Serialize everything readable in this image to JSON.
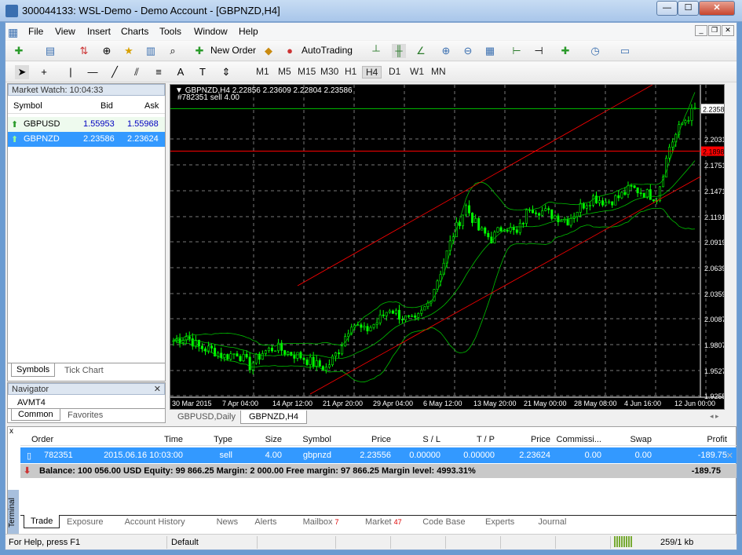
{
  "window": {
    "title": "300044133: WSL-Demo - Demo Account - [GBPNZD,H4]",
    "min": "—",
    "max": "☐",
    "close": "✕"
  },
  "menu": [
    "File",
    "View",
    "Insert",
    "Charts",
    "Tools",
    "Window",
    "Help"
  ],
  "toolbar": {
    "new_order": "New Order",
    "autotrading": "AutoTrading"
  },
  "timeframes": [
    "M1",
    "M5",
    "M15",
    "M30",
    "H1",
    "H4",
    "D1",
    "W1",
    "MN"
  ],
  "active_timeframe": "H4",
  "market_watch": {
    "title": "Market Watch: 10:04:33",
    "columns": [
      "Symbol",
      "Bid",
      "Ask"
    ],
    "rows": [
      {
        "symbol": "GBPUSD",
        "bid": "1.55953",
        "ask": "1.55968"
      },
      {
        "symbol": "GBPNZD",
        "bid": "2.23586",
        "ask": "2.23624",
        "selected": true
      }
    ],
    "tabs": [
      "Symbols",
      "Tick Chart"
    ]
  },
  "navigator": {
    "title": "Navigator",
    "item": "AVMT4",
    "tabs": [
      "Common",
      "Favorites"
    ]
  },
  "chart": {
    "header": "GBPNZD,H4  2.22856 2.23609 2.22804 2.23586",
    "order_label": "#782351 sell 4.00",
    "tabs": [
      "GBPUSD,Daily",
      "GBPNZD,H4"
    ],
    "active_tab": "GBPNZD,H4",
    "colors": {
      "background": "#000000",
      "candles": "#00ff00",
      "bands": "#00c000",
      "channel": "#ff0000",
      "grid": "#c0c0c0"
    }
  },
  "chart_data": {
    "type": "candlestick",
    "symbol": "GBPNZD",
    "timeframe": "H4",
    "y_ticks": [
      "2.20310",
      "2.17510",
      "2.14710",
      "2.11910",
      "2.09190",
      "2.06390",
      "2.03590",
      "2.00870",
      "1.98070",
      "1.95270",
      "1.92550"
    ],
    "ylim": [
      1.9255,
      2.245
    ],
    "x_ticks": [
      "30 Mar 2015",
      "7 Apr 04:00",
      "14 Apr 12:00",
      "21 Apr 20:00",
      "29 Apr 04:00",
      "6 May 12:00",
      "13 May 20:00",
      "21 May 00:00",
      "28 May 08:00",
      "4 Jun 16:00",
      "12 Jun 00:00"
    ],
    "bid_label": "2.23586",
    "order_price_label": "2.18988",
    "order_price": 2.18988,
    "bid": 2.23586,
    "approx_closes": [
      1.985,
      1.99,
      1.978,
      1.975,
      1.968,
      1.972,
      1.958,
      1.972,
      1.978,
      1.972,
      1.968,
      1.96,
      1.955,
      1.975,
      2.005,
      1.995,
      2.005,
      2.02,
      2.01,
      2.005,
      2.025,
      2.06,
      2.1,
      2.13,
      2.105,
      2.095,
      2.11,
      2.1,
      2.13,
      2.125,
      2.12,
      2.115,
      2.13,
      2.14,
      2.135,
      2.14,
      2.15,
      2.145,
      2.14,
      2.195,
      2.22,
      2.235
    ],
    "indicators": [
      "Bollinger Bands",
      "Trend channel"
    ]
  },
  "terminal": {
    "label": "Terminal",
    "columns": [
      "Order",
      "Time",
      "Type",
      "Size",
      "Symbol",
      "Price",
      "S / L",
      "T / P",
      "Price",
      "Commissi...",
      "Swap",
      "Profit"
    ],
    "row": [
      "782351",
      "2015.06.16 10:03:00",
      "sell",
      "4.00",
      "gbpnzd",
      "2.23556",
      "0.00000",
      "0.00000",
      "2.23624",
      "0.00",
      "0.00",
      "-189.75"
    ],
    "summary": "Balance: 100 056.00 USD  Equity: 99 866.25  Margin: 2 000.00  Free margin: 97 866.25  Margin level: 4993.31%",
    "summary_profit": "-189.75",
    "tabs": [
      {
        "label": "Trade"
      },
      {
        "label": "Exposure"
      },
      {
        "label": "Account History"
      },
      {
        "label": "News"
      },
      {
        "label": "Alerts"
      },
      {
        "label": "Mailbox",
        "badge": "7"
      },
      {
        "label": "Market",
        "badge": "47"
      },
      {
        "label": "Code Base"
      },
      {
        "label": "Experts"
      },
      {
        "label": "Journal"
      }
    ]
  },
  "status": {
    "help": "For Help, press F1",
    "profile": "Default",
    "traffic": "259/1 kb"
  }
}
